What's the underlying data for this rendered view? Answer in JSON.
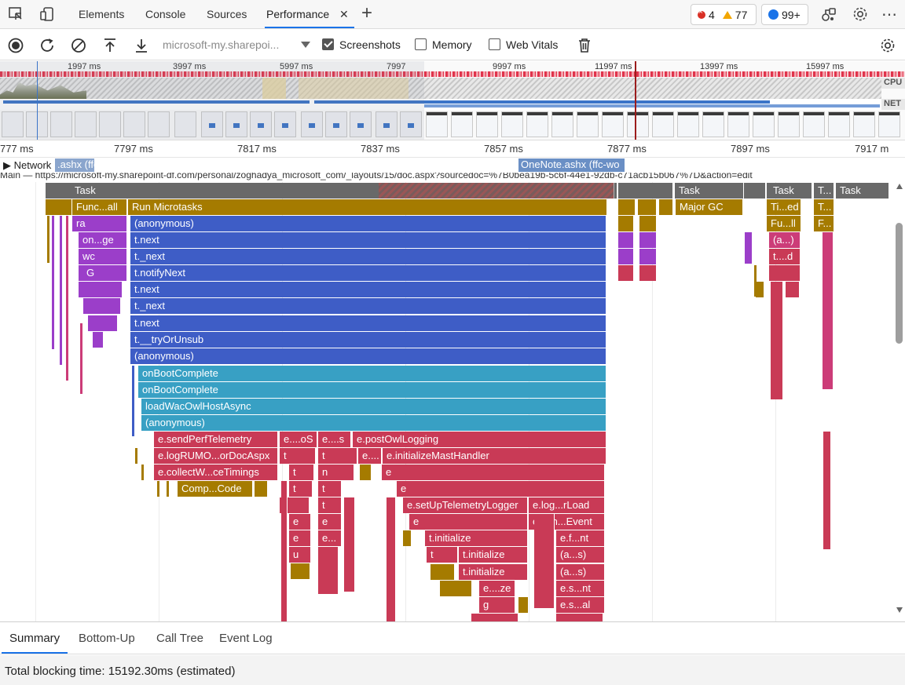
{
  "tabs": {
    "items": [
      "Elements",
      "Console",
      "Sources",
      "Performance"
    ],
    "active": "Performance",
    "close": "✕",
    "add": "+"
  },
  "badges": {
    "errors": "4",
    "warnings": "77",
    "messages": "99+"
  },
  "toolbar": {
    "url": "microsoft-my.sharepoi...",
    "screenshots_label": "Screenshots",
    "screenshots_checked": true,
    "memory_label": "Memory",
    "memory_checked": false,
    "webvitals_label": "Web Vitals",
    "webvitals_checked": false
  },
  "overview": {
    "ticks": [
      "1997 ms",
      "3997 ms",
      "5997 ms",
      "7997",
      "9997 ms",
      "11997 ms",
      "13997 ms",
      "15997 ms"
    ],
    "cpu_label": "CPU",
    "net_label": "NET"
  },
  "ruler": {
    "ticks": [
      "777 ms",
      "7797 ms",
      "7817 ms",
      "7837 ms",
      "7857 ms",
      "7877 ms",
      "7897 ms",
      "7917 m"
    ]
  },
  "network": {
    "toggle": "▶ Network",
    "pill_left": ".ashx (ffc",
    "pill_right": "OneNote.ashx (ffc-wo"
  },
  "main_track": "Main — https://microsoft-my.sharepoint-df.com/personal/zoghadya_microsoft_com/_layouts/15/doc.aspx?sourcedoc=%7B0bea19b-5c6f-44e1-92db-c71acb15b067%7D&action=edit",
  "flame": {
    "task": "Task",
    "funcall": "Func...all",
    "run_microtasks": "Run Microtasks",
    "major_gc": "Major GC",
    "tied": "Ti...ed",
    "t_dots": "T...",
    "t_short": "T...",
    "f_short": "F...",
    "full": "Fu...ll",
    "a_dots": "(a...)",
    "t_d": "t....d",
    "ra": "ra",
    "onge": "on...ge",
    "wc": "wc",
    "g": "G",
    "anonymous": "(anonymous)",
    "tnext": "t.next",
    "t_next": "t._next",
    "notifyNext": "t.notifyNext",
    "tryOrUnsub": "t.__tryOrUnsub",
    "onBootComplete": "onBootComplete",
    "loadWac": "loadWacOwlHostAsync",
    "sendPerf": "e.sendPerfTelemetry",
    "eoS": "e....oS",
    "es": "e....s",
    "postOwl": "e.postOwlLogging",
    "logRUMO": "e.logRUMO...orDocAspx",
    "t": "t",
    "e_dots": "e....",
    "initMast": "e.initializeMastHandler",
    "collectW": "e.collectW...ceTimings",
    "n": "n",
    "e": "e",
    "compCode": "Comp...Code",
    "setUpTel": "e.setUpTelemetryLogger",
    "logRLoad": "e.log...rLoad",
    "senEvent": "e.sen...Event",
    "e_e": "e...",
    "tinit": "t.initialize",
    "efnt": "e.f...nt",
    "u": "u",
    "as": "(a...s)",
    "eze": "e....ze",
    "esnt": "e.s...nt",
    "g2": "g",
    "esal": "e.s...al"
  },
  "bottom": {
    "tabs": [
      "Summary",
      "Bottom-Up",
      "Call Tree",
      "Event Log"
    ],
    "active": "Summary",
    "status": "Total blocking time: 15192.30ms (estimated)"
  }
}
